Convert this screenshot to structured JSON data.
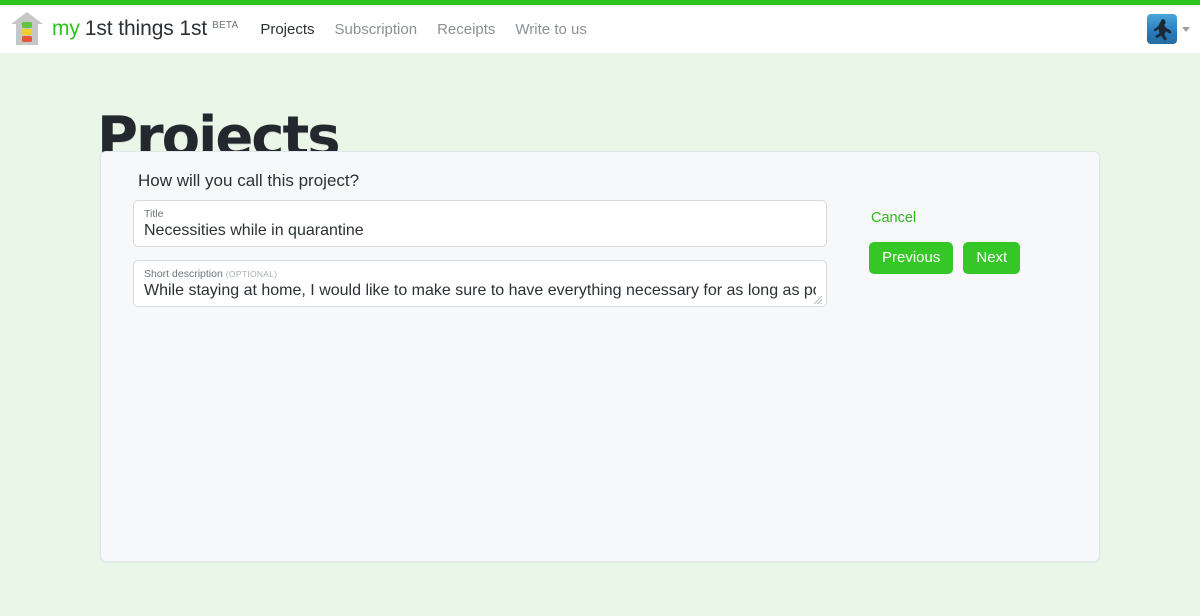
{
  "colors": {
    "accent_green": "#2cc41c",
    "button_green": "#34c726",
    "link_green": "#2cb81c",
    "page_background": "#eaf6e7",
    "card_background": "#f7f8fa",
    "text_dark": "#2b3137",
    "text_muted": "#8b9197"
  },
  "header": {
    "logo_icon": "house-icon",
    "brand": {
      "my": "my",
      "rest": "1st things 1st",
      "beta": "BETA"
    },
    "nav": [
      {
        "label": "Projects",
        "active": true
      },
      {
        "label": "Subscription",
        "active": false
      },
      {
        "label": "Receipts",
        "active": false
      },
      {
        "label": "Write to us",
        "active": false
      }
    ],
    "user": {
      "avatar_icon": "user-avatar-photo",
      "caret_icon": "chevron-down-icon"
    }
  },
  "page": {
    "title": "Projects"
  },
  "form": {
    "question": "How will you call this project?",
    "title_field": {
      "label": "Title",
      "value": "Necessities while in quarantine",
      "placeholder": "Title"
    },
    "description_field": {
      "label": "Short description",
      "optional": "(OPTIONAL)",
      "value": "While staying at home, I would like to make sure to have everything necessary for as long as possible.",
      "placeholder": "Short description"
    },
    "actions": {
      "cancel_label": "Cancel",
      "previous_label": "Previous",
      "next_label": "Next"
    }
  }
}
